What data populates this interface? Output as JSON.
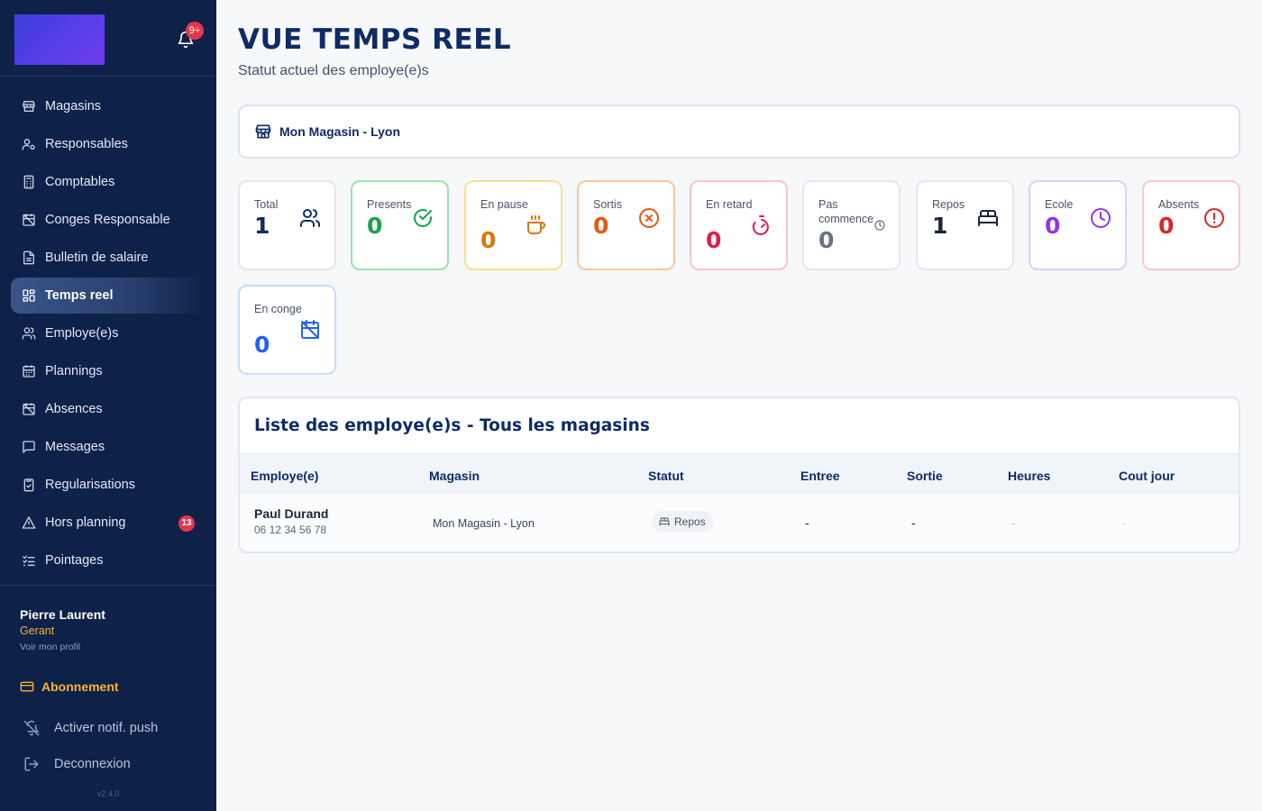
{
  "sidebar": {
    "notification_badge": "9+",
    "items": [
      {
        "label": "Magasins",
        "icon": "store-icon"
      },
      {
        "label": "Responsables",
        "icon": "user-key-icon"
      },
      {
        "label": "Comptables",
        "icon": "calculator-icon"
      },
      {
        "label": "Conges Responsable",
        "icon": "calendar-off-icon"
      },
      {
        "label": "Bulletin de salaire",
        "icon": "file-text-icon"
      },
      {
        "label": "Temps reel",
        "icon": "dashboard-icon",
        "active": true
      },
      {
        "label": "Employe(e)s",
        "icon": "users-icon"
      },
      {
        "label": "Plannings",
        "icon": "calendar-icon"
      },
      {
        "label": "Absences",
        "icon": "calendar-off-icon"
      },
      {
        "label": "Messages",
        "icon": "message-icon"
      },
      {
        "label": "Regularisations",
        "icon": "clipboard-check-icon"
      },
      {
        "label": "Hors planning",
        "icon": "warning-icon",
        "badge": "13"
      },
      {
        "label": "Pointages",
        "icon": "list-checks-icon"
      }
    ],
    "user": {
      "name": "Pierre Laurent",
      "role": "Gerant",
      "profile_link": "Voir mon profil"
    },
    "subscription_label": "Abonnement",
    "push_label": "Activer notif. push",
    "logout_label": "Deconnexion",
    "version": "v2.4.0"
  },
  "header": {
    "title": "VUE TEMPS REEL",
    "subtitle": "Statut actuel des employe(e)s"
  },
  "store_selector": {
    "label": "Mon Magasin - Lyon"
  },
  "stats": [
    {
      "label": "Total",
      "value": "1",
      "color": "#0f2b66",
      "border": "#e3e7ee",
      "icon": "users-icon"
    },
    {
      "label": "Presents",
      "value": "0",
      "color": "#16a34a",
      "border": "#9be3b0",
      "icon": "check-circle-icon"
    },
    {
      "label": "En pause",
      "value": "0",
      "color": "#d97706",
      "border": "#f9df8e",
      "icon": "coffee-icon"
    },
    {
      "label": "Sortis",
      "value": "0",
      "color": "#ea580c",
      "border": "#fbc79c",
      "icon": "x-circle-icon"
    },
    {
      "label": "En retard",
      "value": "0",
      "color": "#e11d48",
      "border": "#f9c3cf",
      "icon": "timer-icon"
    },
    {
      "label": "Pas commence",
      "value": "0",
      "color": "#6b7280",
      "border": "#e3e7ee",
      "icon": "clock-small-icon"
    },
    {
      "label": "Repos",
      "value": "1",
      "color": "#1d2436",
      "border": "#e3e7ee",
      "icon": "bed-icon"
    },
    {
      "label": "Ecole",
      "value": "0",
      "color": "#9333ea",
      "border": "#e3cdfa",
      "icon": "clock-icon"
    },
    {
      "label": "Absents",
      "value": "0",
      "color": "#dc2626",
      "border": "#f9caca",
      "icon": "alert-circle-icon"
    },
    {
      "label": "En conge",
      "value": "0",
      "color": "#2563eb",
      "border": "#c8dcfa",
      "icon": "calendar-off-icon"
    }
  ],
  "table": {
    "title": "Liste des employe(e)s - Tous les magasins",
    "columns": [
      "Employe(e)",
      "Magasin",
      "Statut",
      "Entree",
      "Sortie",
      "Heures",
      "Cout jour"
    ],
    "rows": [
      {
        "name": "Paul Durand",
        "phone": "06 12 34 56 78",
        "store": "Mon Magasin - Lyon",
        "status": "Repos",
        "entry": "-",
        "exit": "-",
        "hours": "-",
        "cost": "-"
      }
    ]
  }
}
